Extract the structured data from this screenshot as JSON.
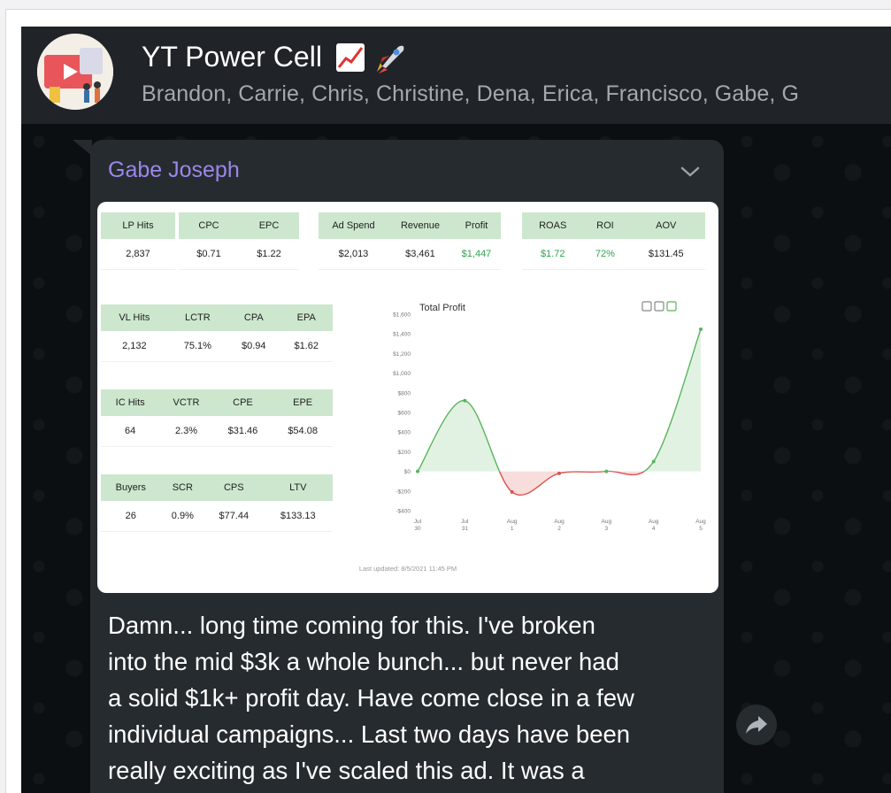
{
  "header": {
    "title": "YT Power Cell",
    "members": "Brandon, Carrie, Chris, Christine, Dena, Erica, Francisco, Gabe, G",
    "icons": [
      "chart-increasing-icon",
      "rocket-icon"
    ]
  },
  "message": {
    "sender": "Gabe Joseph",
    "lines": [
      "Damn... long time coming for this.  I've broken",
      "into the mid $3k a whole bunch... but never had",
      "a solid $1k+ profit day.  Have come close in a few",
      "individual campaigns... Last two days have been",
      "really exciting as I've scaled this ad.  It was a"
    ]
  },
  "dashboard": {
    "tables": [
      {
        "headers": [
          "LP Hits"
        ],
        "values": [
          "2,837"
        ],
        "green": []
      },
      {
        "headers": [
          "CPC",
          "EPC"
        ],
        "values": [
          "$0.71",
          "$1.22"
        ],
        "green": []
      },
      {
        "headers": [
          "Ad Spend",
          "Revenue",
          "Profit"
        ],
        "values": [
          "$2,013",
          "$3,461",
          "$1,447"
        ],
        "green": [
          2
        ]
      },
      {
        "headers": [
          "ROAS",
          "ROI",
          "AOV"
        ],
        "values": [
          "$1.72",
          "72%",
          "$131.45"
        ],
        "green": [
          0,
          1
        ]
      },
      {
        "headers": [
          "VL Hits",
          "LCTR",
          "CPA",
          "EPA"
        ],
        "values": [
          "2,132",
          "75.1%",
          "$0.94",
          "$1.62"
        ],
        "green": []
      },
      {
        "headers": [
          "IC Hits",
          "VCTR",
          "CPE",
          "EPE"
        ],
        "values": [
          "64",
          "2.3%",
          "$31.46",
          "$54.08"
        ],
        "green": []
      },
      {
        "headers": [
          "Buyers",
          "SCR",
          "CPS",
          "LTV"
        ],
        "values": [
          "26",
          "0.9%",
          "$77.44",
          "$133.13"
        ],
        "green": []
      }
    ],
    "last_updated": "Last updated: 8/5/2021 11:45 PM"
  },
  "chart_data": {
    "type": "area",
    "title": "Total Profit",
    "x": [
      [
        "Jul",
        "30"
      ],
      [
        "Jul",
        "31"
      ],
      [
        "Aug",
        "1"
      ],
      [
        "Aug",
        "2"
      ],
      [
        "Aug",
        "3"
      ],
      [
        "Aug",
        "4"
      ],
      [
        "Aug",
        "5"
      ]
    ],
    "y_ticks": [
      "$1,600",
      "$1,400",
      "$1,200",
      "$1,000",
      "$800",
      "$600",
      "$400",
      "$200",
      "$0",
      "-$200",
      "-$400"
    ],
    "ylim": [
      -400,
      1600
    ],
    "series": [
      {
        "values": [
          0,
          720,
          -210,
          -20,
          0,
          100,
          1447
        ]
      }
    ],
    "colors": {
      "positive": "#58b55c",
      "negative": "#d9534f"
    },
    "toolbar_icons": [
      "calendar-icon",
      "calendar-icon",
      "calendar-icon"
    ]
  },
  "colors": {
    "sender": "#9b87e8",
    "green_text": "#2ea44f",
    "header_green": "#cce7cd"
  }
}
